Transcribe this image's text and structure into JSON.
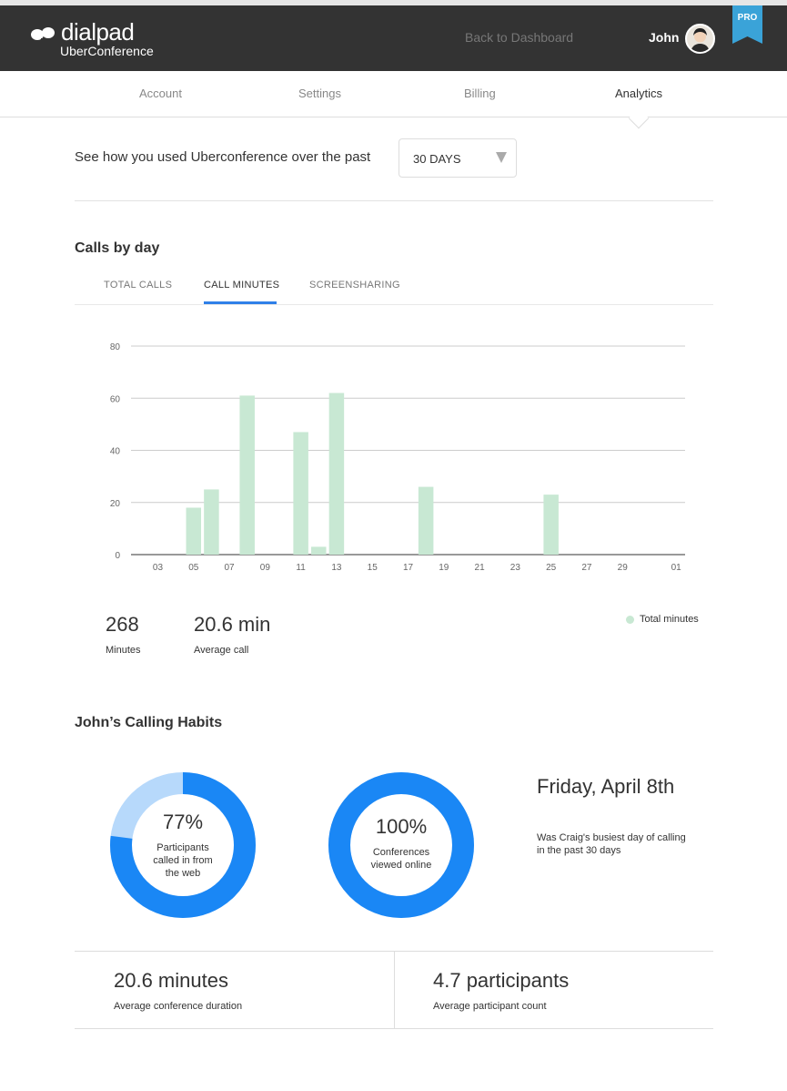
{
  "header": {
    "brand": "dialpad",
    "product": "UberConference",
    "back_link": "Back to Dashboard",
    "user_name": "John",
    "badge": "PRO"
  },
  "nav": {
    "tabs": [
      {
        "label": "Account",
        "active": false
      },
      {
        "label": "Settings",
        "active": false
      },
      {
        "label": "Billing",
        "active": false
      },
      {
        "label": "Analytics",
        "active": true
      }
    ]
  },
  "range": {
    "label": "See how you used Uberconference over the past",
    "selected": "30 DAYS"
  },
  "calls_by_day": {
    "title": "Calls by day",
    "tabs": [
      {
        "label": "TOTAL CALLS",
        "active": false
      },
      {
        "label": "CALL MINUTES",
        "active": true
      },
      {
        "label": "SCREENSHARING",
        "active": false
      }
    ]
  },
  "chart_data": {
    "type": "bar",
    "title": "",
    "xlabel": "",
    "ylabel": "",
    "ylim": [
      0,
      80
    ],
    "yticks": [
      0,
      20,
      40,
      60,
      80
    ],
    "xticks": [
      "03",
      "05",
      "07",
      "09",
      "11",
      "13",
      "15",
      "17",
      "19",
      "21",
      "23",
      "25",
      "27",
      "29",
      "01"
    ],
    "grid": true,
    "bar_color": "#c8e8d3",
    "categories": [
      "02",
      "03",
      "04",
      "05",
      "06",
      "07",
      "08",
      "09",
      "10",
      "11",
      "12",
      "13",
      "14",
      "15",
      "16",
      "17",
      "18",
      "19",
      "20",
      "21",
      "22",
      "23",
      "24",
      "25",
      "26",
      "27",
      "28",
      "29",
      "30",
      "31",
      "01"
    ],
    "series": [
      {
        "name": "Total minutes",
        "values": [
          0,
          0,
          0,
          18,
          25,
          0,
          61,
          0,
          0,
          47,
          3,
          62,
          0,
          0,
          0,
          0,
          26,
          0,
          0,
          0,
          0,
          0,
          0,
          23,
          0,
          0,
          0,
          0,
          0,
          0,
          0
        ]
      }
    ],
    "legend": {
      "placement": "bottom-right",
      "label": "Total minutes"
    }
  },
  "stats": {
    "minutes_value": "268",
    "minutes_label": "Minutes",
    "avg_value": "20.6 min",
    "avg_label": "Average call"
  },
  "habits": {
    "title": "John’s Calling Habits",
    "web": {
      "percent_text": "77%",
      "fraction": 0.77,
      "caption": "Participants called in from the web"
    },
    "online": {
      "percent_text": "100%",
      "fraction": 1.0,
      "caption": "Conferences viewed online"
    },
    "busiest_day": "Friday, April 8th",
    "busiest_caption": "Was Craig's busiest day of calling in the past 30 days"
  },
  "summary": {
    "duration_value": "20.6 minutes",
    "duration_label": "Average conference duration",
    "participants_value": "4.7 participants",
    "participants_label": "Average participant count"
  },
  "colors": {
    "topbar": "#333333",
    "accent": "#2f80e8",
    "donut_blue": "#1a87f5",
    "donut_light": "#b7d9fb",
    "bar": "#c8e8d3",
    "pro_badge": "#3aa3d8"
  }
}
